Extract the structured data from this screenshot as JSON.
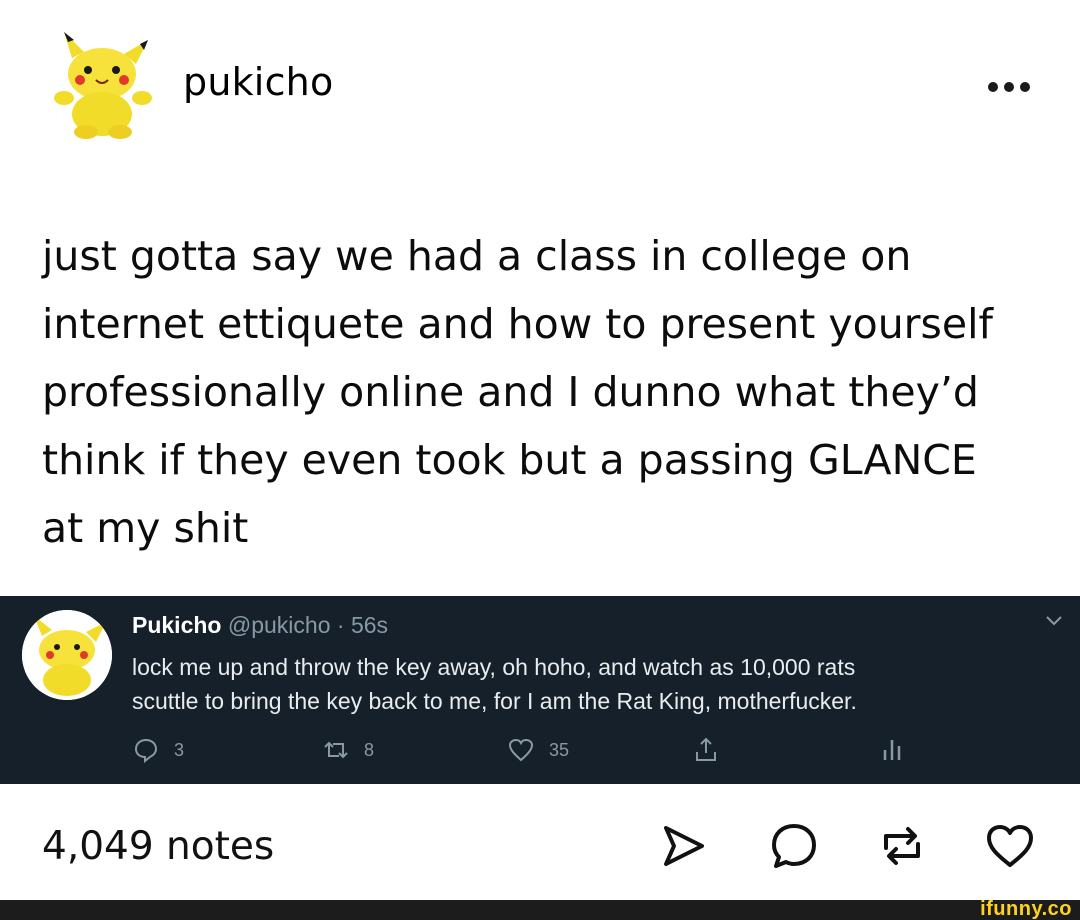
{
  "header": {
    "username": "pukicho",
    "avatar_icon": "pikachu-plush-icon",
    "more_icon": "more-dots-icon"
  },
  "post": {
    "text_lines": [
      "just gotta say we had a class in college on",
      "internet ettiquete and how to present yourself",
      "professionally online and I dunno what they’d",
      "think if they even took but a passing GLANCE",
      "at my shit"
    ]
  },
  "tweet": {
    "name": "Pukicho",
    "handle": "@pukicho",
    "separator": " · ",
    "time": "56s",
    "text_lines": [
      "lock me up and throw the key away, oh hoho, and watch as 10,000 rats",
      "scuttle to bring the key back to me, for I am the Rat King, motherfucker."
    ],
    "replies": "3",
    "retweets": "8",
    "likes": "35",
    "background": "#15202b"
  },
  "footer": {
    "notes": "4,049 notes",
    "icons": [
      "share-icon",
      "reply-icon",
      "reblog-icon",
      "like-icon"
    ]
  },
  "watermark": {
    "text": "ifunny.co"
  }
}
